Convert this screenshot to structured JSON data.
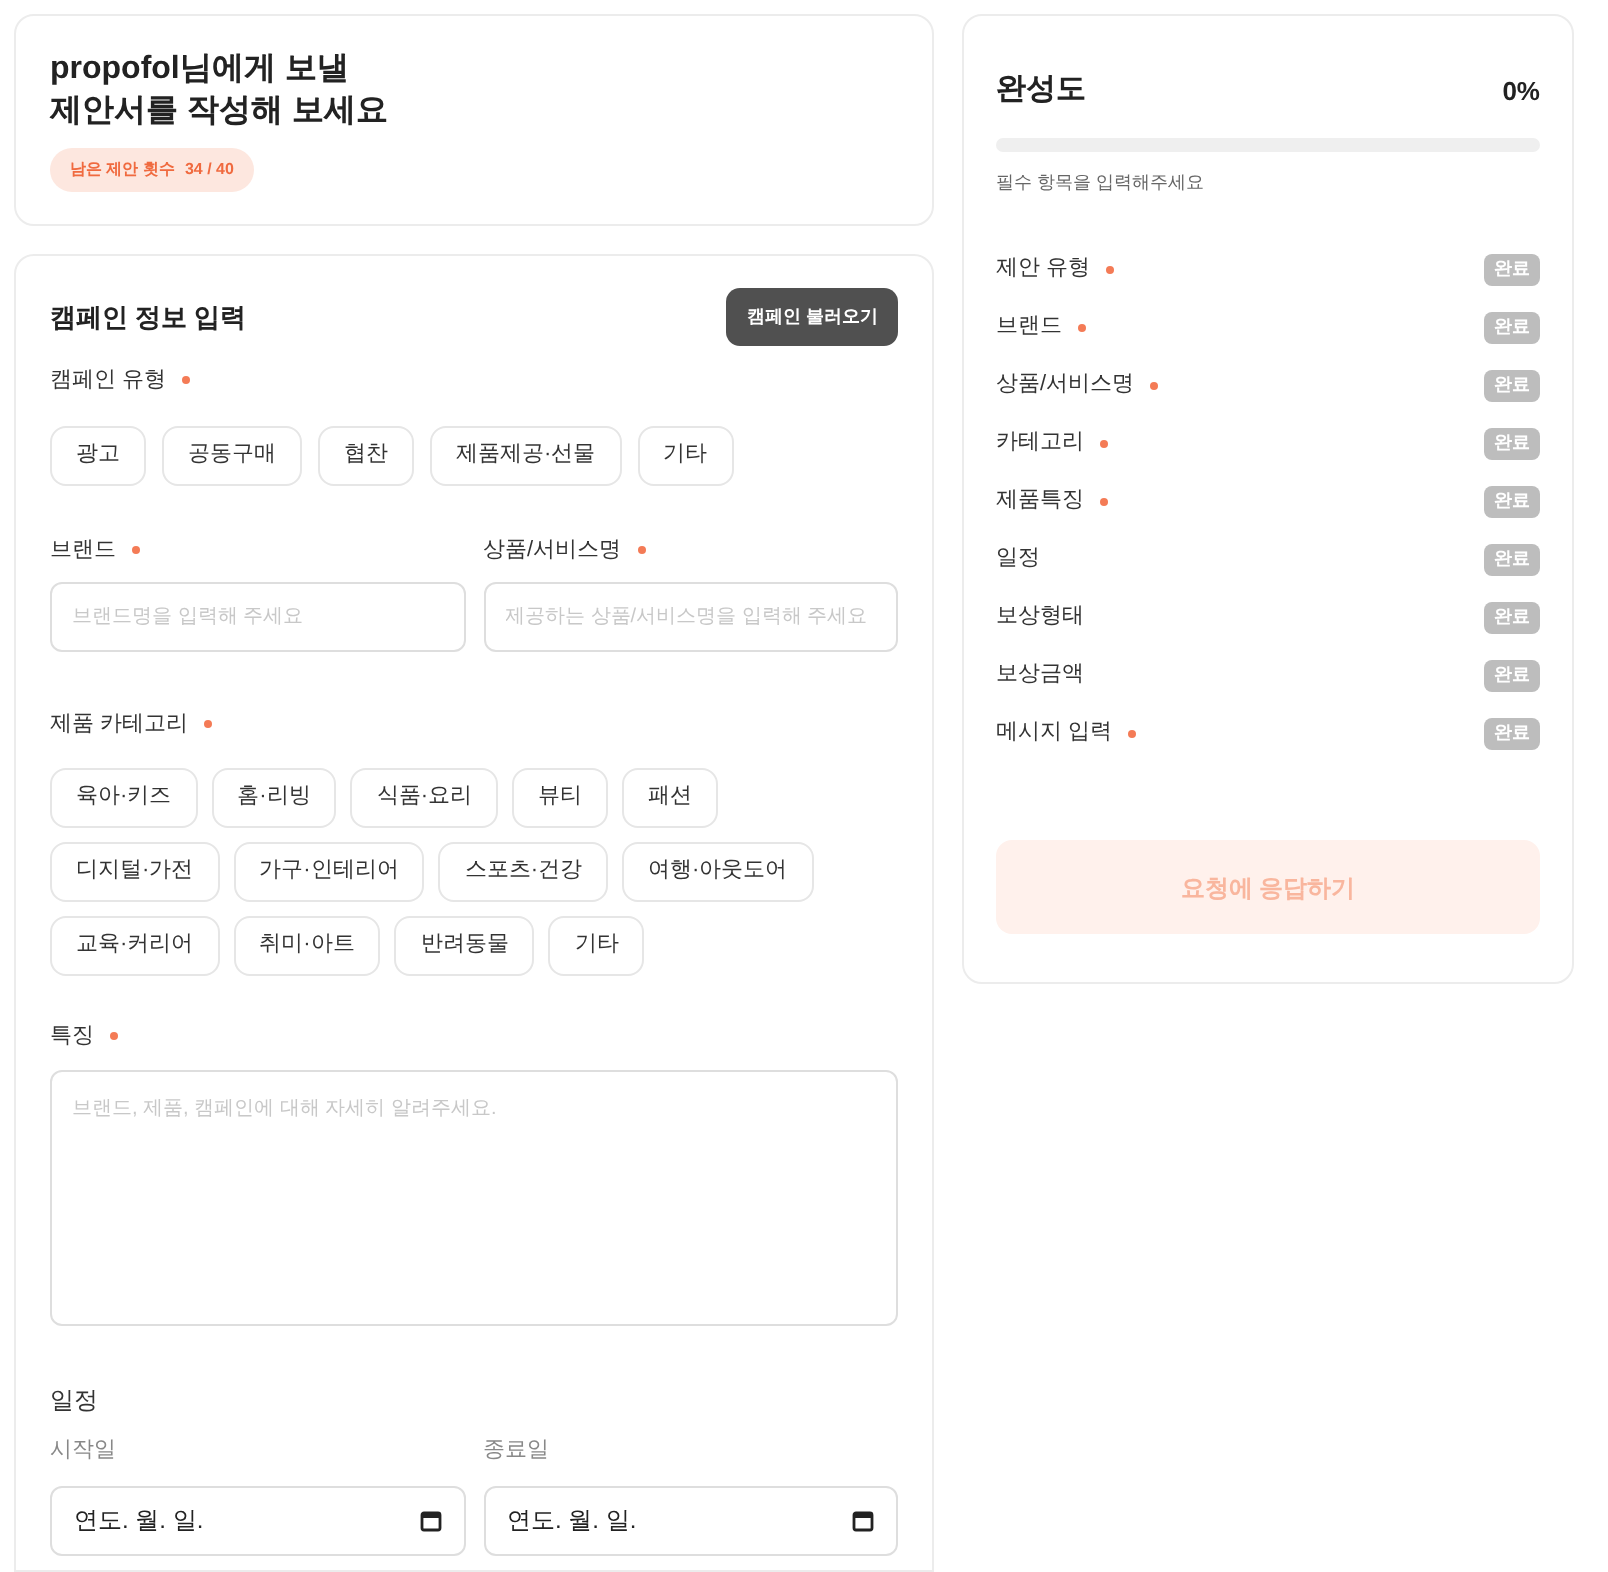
{
  "header": {
    "title_line_1": "propofol님에게 보낼",
    "title_line_2": "제안서를 작성해 보세요",
    "quota_label": "남은 제안 횟수",
    "quota_value": "34 / 40"
  },
  "form": {
    "title": "캠페인 정보 입력",
    "load_button": "캠페인 불러오기",
    "campaign_type": {
      "label": "캠페인 유형",
      "required": true,
      "options": [
        {
          "label": "광고",
          "selected": false
        },
        {
          "label": "공동구매",
          "selected": false
        },
        {
          "label": "협찬",
          "selected": false
        },
        {
          "label": "제품제공·선물",
          "selected": false
        },
        {
          "label": "기타",
          "selected": false
        }
      ]
    },
    "brand": {
      "label": "브랜드",
      "required": true,
      "placeholder": "브랜드명을 입력해 주세요"
    },
    "product": {
      "label": "상품/서비스명",
      "required": true,
      "placeholder": "제공하는 상품/서비스명을 입력해 주세요"
    },
    "category": {
      "label": "제품 카테고리",
      "required": true,
      "options": [
        {
          "label": "육아·키즈",
          "selected": false
        },
        {
          "label": "홈·리빙",
          "selected": false
        },
        {
          "label": "식품·요리",
          "selected": false
        },
        {
          "label": "뷰티",
          "selected": false
        },
        {
          "label": "패션",
          "selected": false
        },
        {
          "label": "디지털·가전",
          "selected": false
        },
        {
          "label": "가구·인테리어",
          "selected": false
        },
        {
          "label": "스포츠·건강",
          "selected": false
        },
        {
          "label": "여행·아웃도어",
          "selected": false
        },
        {
          "label": "교육·커리어",
          "selected": false
        },
        {
          "label": "취미·아트",
          "selected": false
        },
        {
          "label": "반려동물",
          "selected": false
        },
        {
          "label": "기타",
          "selected": false
        }
      ]
    },
    "features": {
      "label": "특징",
      "required": true,
      "placeholder": "브랜드, 제품, 캠페인에 대해 자세히 알려주세요."
    },
    "schedule": {
      "label": "일정",
      "start_label": "시작일",
      "start_value": "연도. 월. 일.",
      "end_label": "종료일",
      "end_value": "연도. 월. 일."
    }
  },
  "progress": {
    "title": "완성도",
    "percent": "0%",
    "level": 0,
    "hint": "필수 항목을 입력해주세요",
    "items": [
      {
        "label": "제안 유형",
        "required": true,
        "badge": "완료",
        "done": false
      },
      {
        "label": "브랜드",
        "required": true,
        "badge": "완료",
        "done": false
      },
      {
        "label": "상품/서비스명",
        "required": true,
        "badge": "완료",
        "done": false
      },
      {
        "label": "카테고리",
        "required": true,
        "badge": "완료",
        "done": false
      },
      {
        "label": "제품특징",
        "required": true,
        "badge": "완료",
        "done": false
      },
      {
        "label": "일정",
        "required": false,
        "badge": "완료",
        "done": false
      },
      {
        "label": "보상형태",
        "required": false,
        "badge": "완료",
        "done": false
      },
      {
        "label": "보상금액",
        "required": false,
        "badge": "완료",
        "done": false
      },
      {
        "label": "메시지 입력",
        "required": true,
        "badge": "완료",
        "done": false
      }
    ],
    "submit": {
      "label": "요청에 응답하기",
      "disabled": true
    }
  }
}
